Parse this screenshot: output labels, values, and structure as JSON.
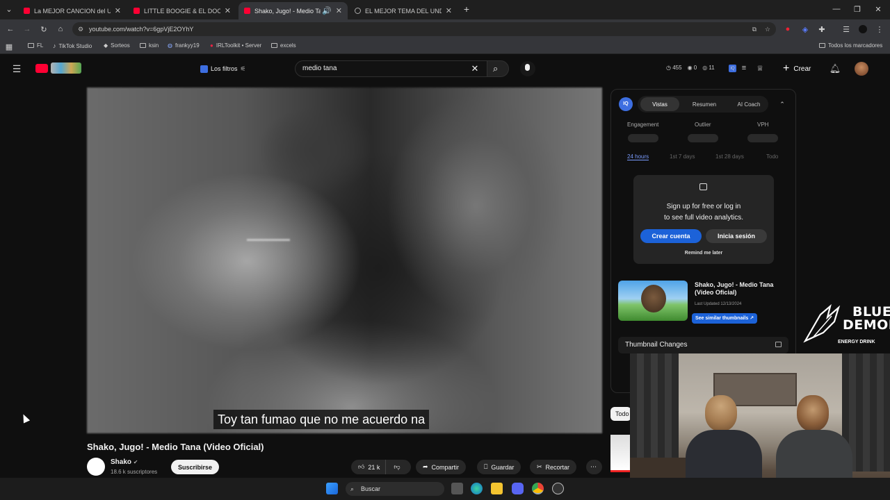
{
  "browser": {
    "tabs": [
      {
        "label": "La MEJOR CANCION del UNDE",
        "active": false
      },
      {
        "label": "LITTLE BOOGIE & EL DOCTOR",
        "active": false
      },
      {
        "label": "Shako, Jugo! - Medio Tana",
        "active": true
      },
      {
        "label": "EL MEJOR TEMA DEL UNDER E",
        "active": false
      }
    ],
    "url": "youtube.com/watch?v=6gpVjE2OYhY",
    "bookmarks": [
      "FL",
      "TikTok Studio",
      "Sorteos",
      "ksin",
      "frankyy19",
      "IRLToolkit • Server",
      "excels"
    ],
    "all_bookmarks": "Todos los marcadores"
  },
  "yt_header": {
    "filters_label": "Los filtros",
    "search_value": "medio tana",
    "stats": {
      "a": "455",
      "b": "0",
      "c": "11"
    },
    "create_label": "Crear"
  },
  "video": {
    "caption": "Toy tan fumao que no me acuerdo na",
    "title": "Shako, Jugo! - Medio Tana (Video Oficial)",
    "channel": "Shako",
    "subscribers": "18.6 k suscriptores",
    "subscribe_label": "Suscribirse",
    "likes": "21 k",
    "share_label": "Compartir",
    "save_label": "Guardar",
    "clip_label": "Recortar"
  },
  "panel": {
    "tabs": [
      "Vistas",
      "Resumen",
      "AI Coach"
    ],
    "metrics": [
      "Engagement",
      "Outlier",
      "VPH"
    ],
    "ranges": [
      "24 hours",
      "1st 7 days",
      "1st 28 days",
      "Todo"
    ],
    "signup_line1": "Sign up for free or log in",
    "signup_line2": "to see full video analytics.",
    "create_account": "Crear cuenta",
    "login": "Inicia sesión",
    "remind": "Remind me later",
    "thumb_title": "Shako, Jugo! - Medio Tana (Video Oficial)",
    "last_updated": "Last Updated 12/13/2024",
    "similar": "See similar thumbnails ↗",
    "thumbnail_changes": "Thumbnail Changes",
    "side_chip": "Todo"
  },
  "overlay": {
    "brand_line1": "BLUE",
    "brand_line2": "DEMON",
    "brand_sub": "ENERGY DRINK"
  },
  "taskbar": {
    "search": "Buscar"
  },
  "colors": {
    "accent": "#1c62d8",
    "yt_red": "#ff0033",
    "bg": "#0f0f0f"
  }
}
